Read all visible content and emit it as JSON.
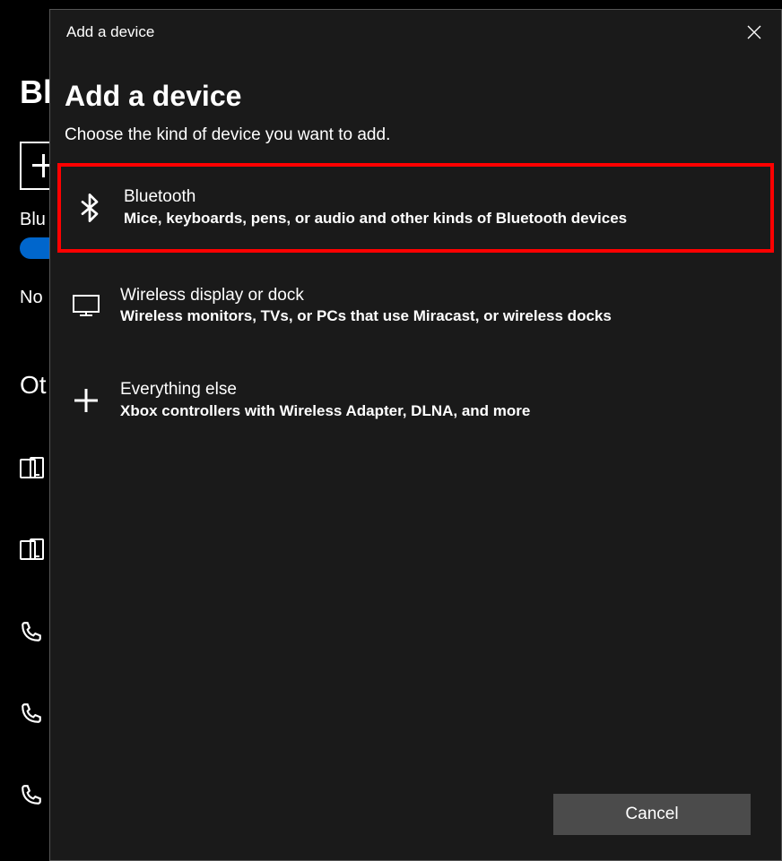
{
  "background": {
    "heading_fragment": "Bl",
    "row1_fragment": "Blu",
    "row2_fragment": "No",
    "row3_fragment": "Ot"
  },
  "dialog": {
    "header_title": "Add a device",
    "main_title": "Add a device",
    "subtitle": "Choose the kind of device you want to add.",
    "options": [
      {
        "title": "Bluetooth",
        "description": "Mice, keyboards, pens, or audio and other kinds of Bluetooth devices"
      },
      {
        "title": "Wireless display or dock",
        "description": "Wireless monitors, TVs, or PCs that use Miracast, or wireless docks"
      },
      {
        "title": "Everything else",
        "description": "Xbox controllers with Wireless Adapter, DLNA, and more"
      }
    ],
    "cancel_label": "Cancel"
  }
}
